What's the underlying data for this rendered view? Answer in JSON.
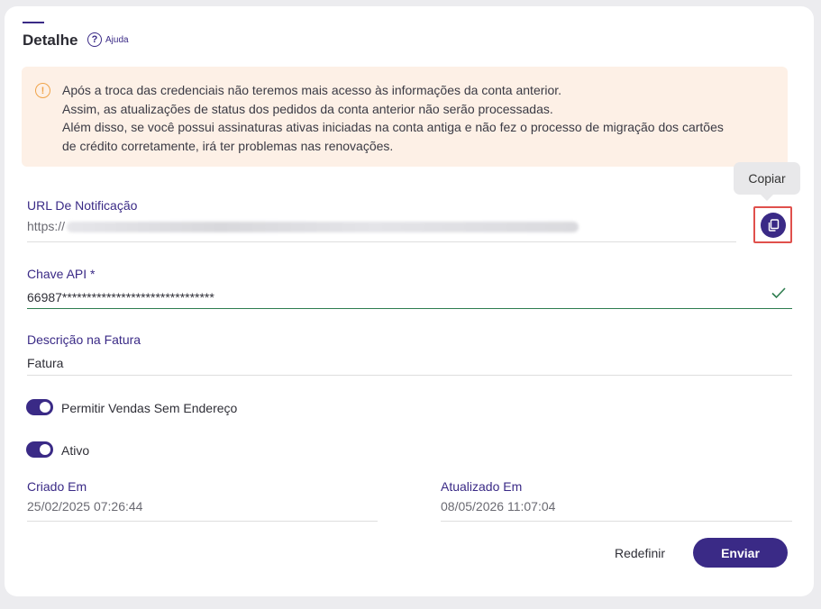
{
  "header": {
    "title": "Detalhe",
    "help_label": "Ajuda"
  },
  "alert": {
    "lines": [
      "Após a troca das credenciais não teremos mais acesso às informações da conta anterior.",
      "Assim, as atualizações de status dos pedidos da conta anterior não serão processadas.",
      "Além disso, se você possui assinaturas ativas iniciadas na conta antiga e não fez o processo de migração dos cartões",
      "de crédito corretamente, irá ter problemas nas renovações."
    ],
    "color": "#fdf0e6"
  },
  "notification": {
    "label": "URL De Notificação",
    "value_prefix": "https://",
    "copy_tooltip": "Copiar"
  },
  "api_key": {
    "label": "Chave API *",
    "value": "66987*******************************"
  },
  "invoice": {
    "label": "Descrição na Fatura",
    "value": "Fatura"
  },
  "toggles": [
    {
      "label": "Permitir Vendas Sem Endereço",
      "on": true
    },
    {
      "label": "Ativo",
      "on": true
    }
  ],
  "created": {
    "label": "Criado Em",
    "value": "25/02/2025 07:26:44"
  },
  "updated": {
    "label": "Atualizado Em",
    "value": "08/05/2026 11:07:04"
  },
  "actions": {
    "reset_label": "Redefinir",
    "send_label": "Enviar"
  },
  "colors": {
    "primary": "#3a2a86",
    "warning": "#f0a44a",
    "success": "#2e7d4f",
    "highlight": "#e0504c"
  }
}
